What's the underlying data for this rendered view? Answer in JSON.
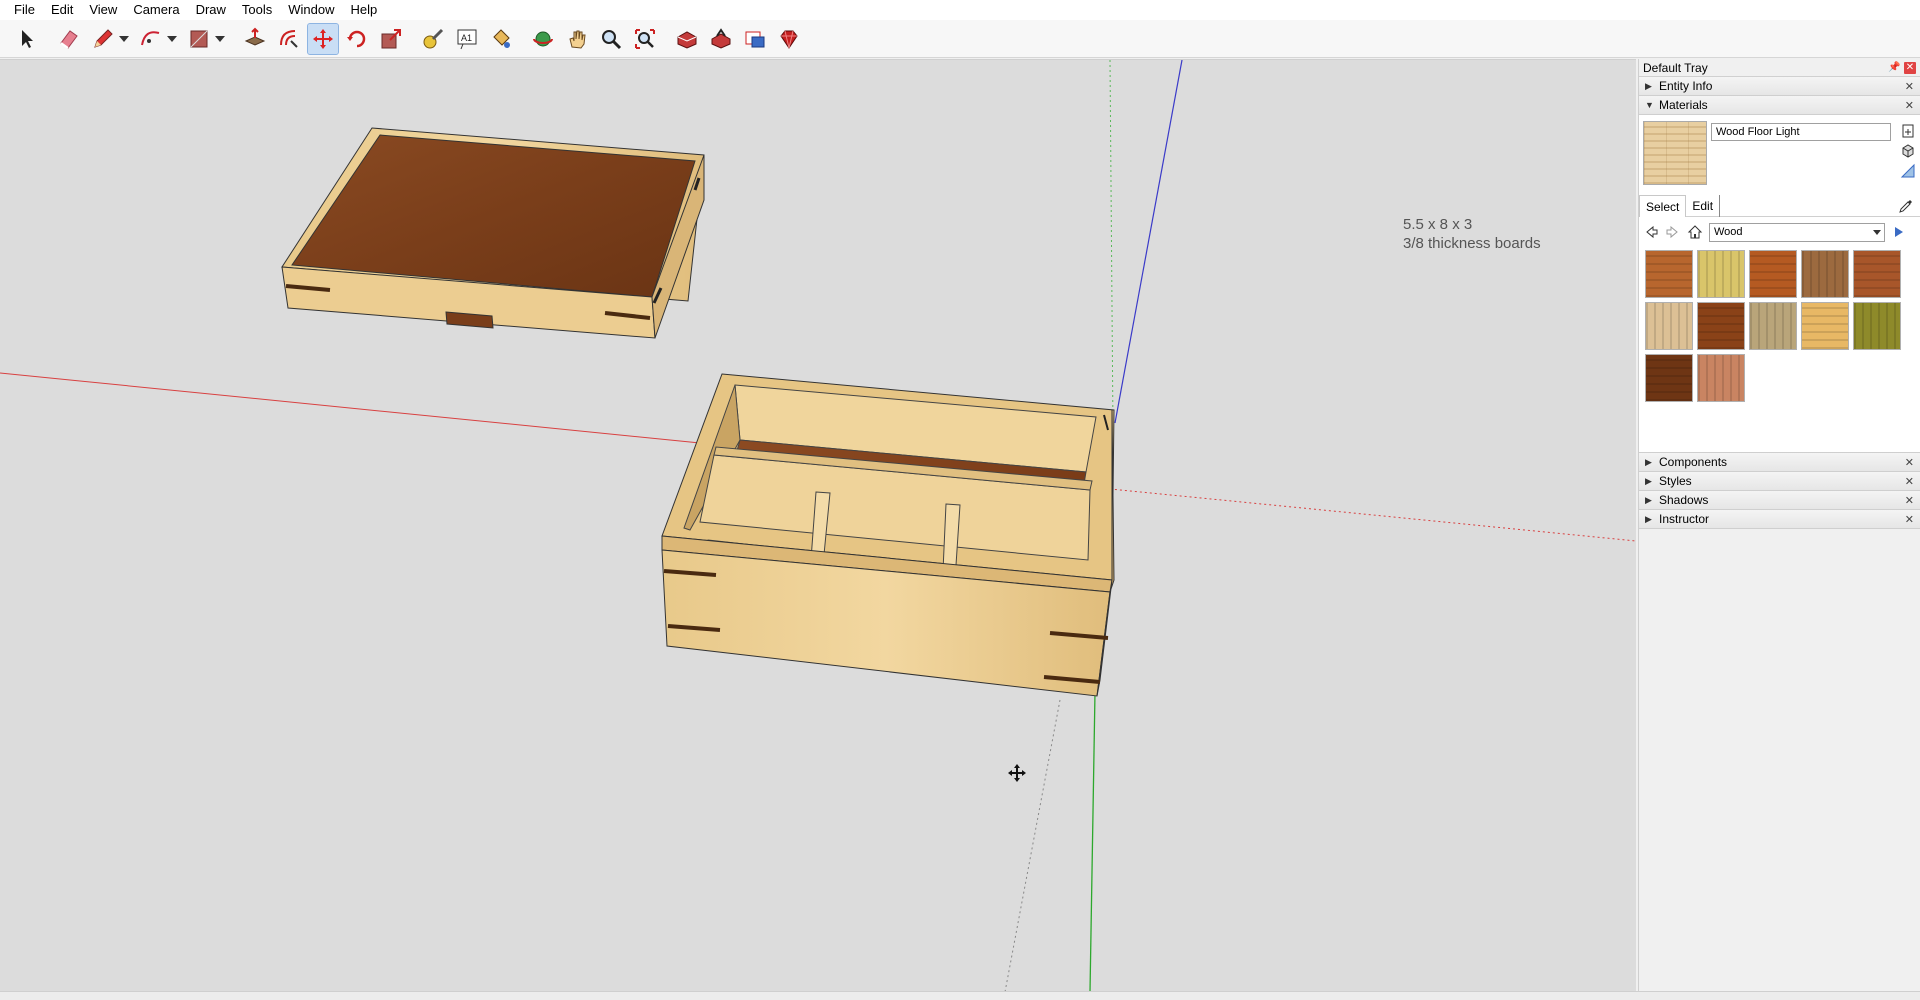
{
  "menu": [
    "File",
    "Edit",
    "View",
    "Camera",
    "Draw",
    "Tools",
    "Window",
    "Help"
  ],
  "toolbar": {
    "tools": [
      {
        "name": "select-tool",
        "icon": "arrow-icon"
      },
      {
        "name": "eraser-tool",
        "icon": "eraser-icon"
      },
      {
        "name": "pencil-tool",
        "icon": "pencil-icon"
      },
      {
        "name": "arc-tool",
        "icon": "arc-icon"
      },
      {
        "name": "rectangle-tool",
        "icon": "rectangle-icon"
      },
      {
        "name": "push-pull-tool",
        "icon": "push-pull-icon"
      },
      {
        "name": "offset-tool",
        "icon": "offset-icon"
      },
      {
        "name": "move-tool",
        "icon": "move-icon",
        "active": true
      },
      {
        "name": "rotate-tool",
        "icon": "rotate-icon"
      },
      {
        "name": "scale-tool",
        "icon": "scale-icon"
      },
      {
        "name": "tape-measure-tool",
        "icon": "tape-measure-icon"
      },
      {
        "name": "text-tool",
        "icon": "text-icon"
      },
      {
        "name": "paint-bucket-tool",
        "icon": "paint-bucket-icon"
      },
      {
        "name": "orbit-tool",
        "icon": "orbit-icon"
      },
      {
        "name": "pan-tool",
        "icon": "pan-icon"
      },
      {
        "name": "zoom-tool",
        "icon": "zoom-icon"
      },
      {
        "name": "zoom-extents-tool",
        "icon": "zoom-extents-icon"
      },
      {
        "name": "warehouse-tool",
        "icon": "warehouse-icon"
      },
      {
        "name": "share-model-tool",
        "icon": "share-icon"
      },
      {
        "name": "extension-tool",
        "icon": "extension-icon"
      },
      {
        "name": "ruby-tool",
        "icon": "ruby-icon"
      }
    ]
  },
  "viewport": {
    "note_line1": "5.5 x 8 x 3",
    "note_line2": "3/8 thickness boards"
  },
  "tray": {
    "title": "Default Tray",
    "panels": {
      "entity_info": "Entity Info",
      "materials": "Materials",
      "components": "Components",
      "styles": "Styles",
      "shadows": "Shadows",
      "instructor": "Instructor"
    },
    "materials": {
      "current_name": "Wood Floor Light",
      "tab_select": "Select",
      "tab_edit": "Edit",
      "library": "Wood",
      "swatches": [
        "#b8662e",
        "#d9c56a",
        "#b55a22",
        "#9c6a3f",
        "#a8562a",
        "#dcc095",
        "#8a4218",
        "#b9a57a",
        "#e8b865",
        "#8e8a2a",
        "#6e3514",
        "#c98462"
      ]
    }
  }
}
